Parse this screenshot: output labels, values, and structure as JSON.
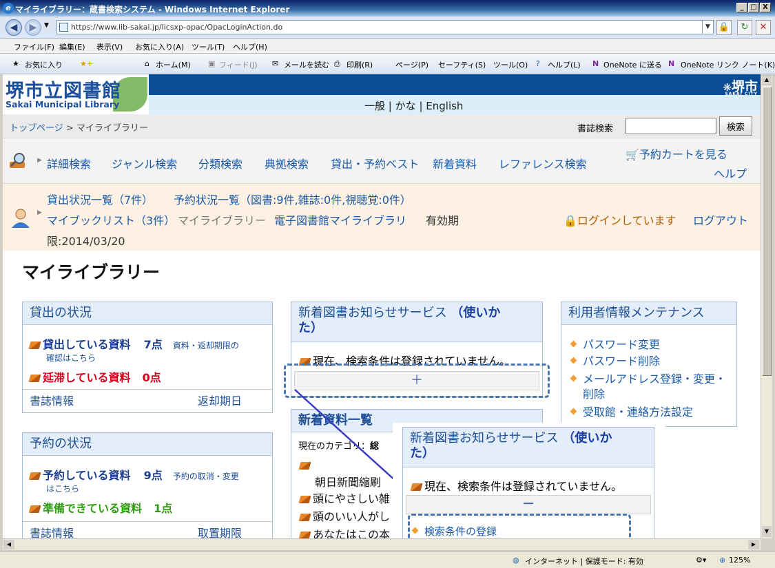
{
  "window": {
    "title": "マイライブラリー：蔵書検索システム - Windows Internet Explorer",
    "url": "https://www.lib-sakai.jp/licsxp-opac/OpacLoginAction.do",
    "minimize": "_",
    "maximize": "□",
    "close": "X"
  },
  "menu": [
    "ファイル(F)",
    "編集(E)",
    "表示(V)",
    "お気に入り(A)",
    "ツール(T)",
    "ヘルプ(H)"
  ],
  "favbar": {
    "favorites": "お気に入り",
    "home": "ホーム(M)",
    "feed": "フィード(J)",
    "mail": "メールを読む",
    "print": "印刷(R)",
    "page": "ページ(P)",
    "safety": "セーフティ(S)",
    "tools": "ツール(O)",
    "help": "ヘルプ(L)",
    "onenote_send": "OneNote に送る",
    "onenote_link": "OneNote リンク ノート(K)"
  },
  "site": {
    "logo_jp": "堺市立図書館",
    "logo_en": "Sakai Municipal Library",
    "city": "堺市",
    "city_en": "SAKAI CITY",
    "lang": {
      "general": "一般",
      "kana": "かな",
      "english": "English",
      "sep": "|"
    },
    "breadcrumb": {
      "top": "トップページ",
      "sep": ">",
      "current": "マイライブラリー"
    },
    "search_label": "書誌検索",
    "search_button": "検索"
  },
  "nav": {
    "items": [
      "詳細検索",
      "ジャンル検索",
      "分類検索",
      "典拠検索",
      "貸出・予約ベスト",
      "新着資料",
      "レファレンス検索"
    ],
    "cart": "予約カートを見る",
    "help": "ヘルプ"
  },
  "user": {
    "loans": "貸出状況一覧（7件）",
    "reservations": "予約状況一覧（図書:9件,雑誌:0件,視聴覚:0件）",
    "mybooklist": "マイブックリスト（3件）",
    "mylibrary": "マイライブラリー",
    "elibrary": "電子図書館マイライブラリ",
    "valid_prefix": "有効期",
    "valid_rest": "限:2014/03/20",
    "login_status": "ログインしています",
    "logout": "ログアウト"
  },
  "page_title": "マイライブラリー",
  "loan_panel": {
    "title": "貸出の状況",
    "borrowed_label": "貸出している資料",
    "borrowed_count": "7点",
    "borrowed_note1": "資料・返却期限の",
    "borrowed_note2": "確認はこちら",
    "overdue_label": "延滞している資料",
    "overdue_count": "0点",
    "col1": "書誌情報",
    "col2": "返却期日"
  },
  "reserve_panel": {
    "title": "予約の状況",
    "reserved_label": "予約している資料",
    "reserved_count": "9点",
    "reserved_note1": "予約の取消・変更",
    "reserved_note2": "はこちら",
    "ready_label": "準備できている資料",
    "ready_count": "1点",
    "col1": "書誌情報",
    "col2": "取置期限"
  },
  "notify_panel": {
    "title": "新着図書お知らせサービス",
    "howto1": "（使いか",
    "howto2": "た）",
    "message": "現在、検索条件は登録されていません。",
    "plus": "＋"
  },
  "newarrivals_panel": {
    "title": "新着資料一覧",
    "category_label": "現在のカテゴリ：",
    "category_value": "総",
    "items": [
      "朝日新聞縮刷",
      "頭にやさしい雑",
      "頭のいい人がし",
      "あなたはこの本"
    ]
  },
  "userinfo_panel": {
    "title": "利用者情報メンテナンス",
    "items": [
      "パスワード変更",
      "パスワード削除",
      "メールアドレス登録・変更・",
      "削除",
      "受取館・連絡方法設定"
    ]
  },
  "callout": {
    "title": "新着図書お知らせサービス",
    "howto1": "（使いか",
    "howto2": "た）",
    "message": "現在、検索条件は登録されていません。",
    "minus": "－",
    "register": "検索条件の登録"
  },
  "status": {
    "zone": "インターネット | 保護モード: 有効",
    "zoom": "125%"
  },
  "colors": {
    "brand_blue": "#0b4c96",
    "link": "#1b5aa8",
    "overdue": "#d9001b",
    "ready": "#2f9a12",
    "user_bg": "#fdf1e4"
  }
}
